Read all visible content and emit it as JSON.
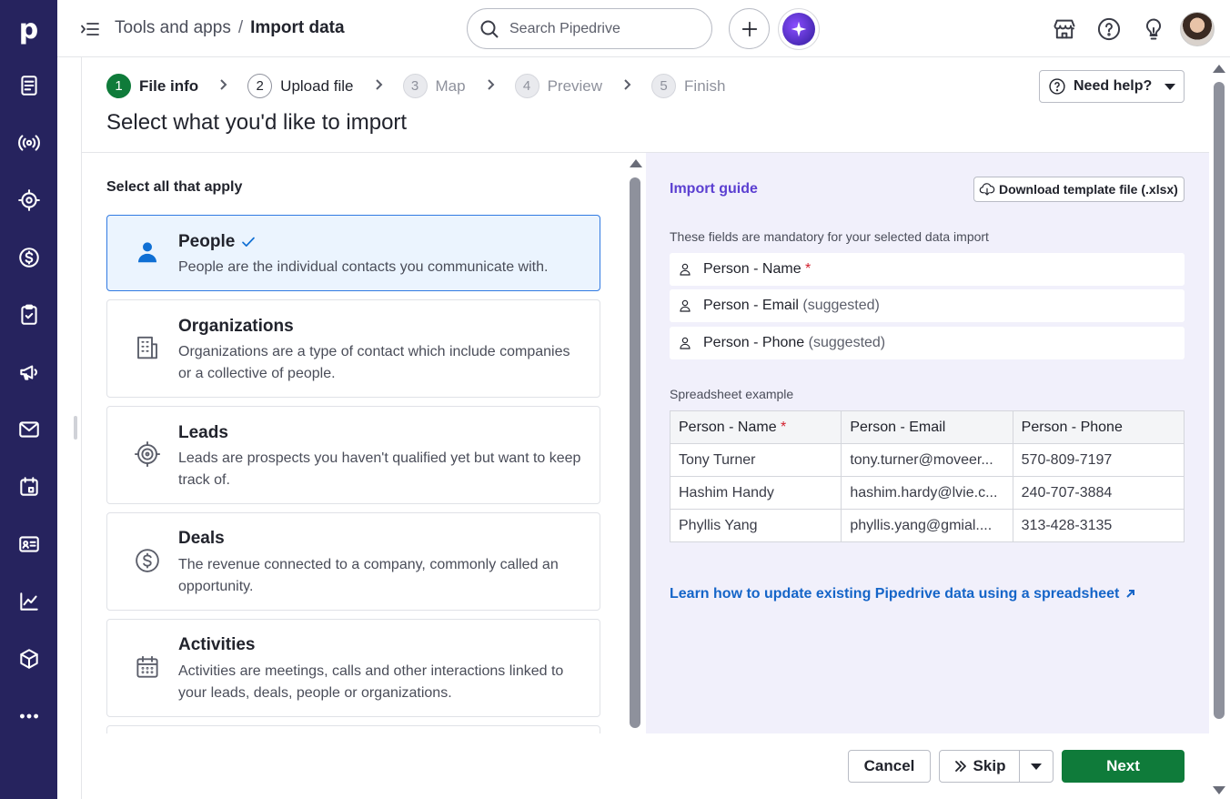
{
  "nav": {
    "logo": "p",
    "items": [
      "leads-inbox-icon",
      "broadcast-icon",
      "target-icon",
      "dollar-icon",
      "clipboard-check-icon",
      "megaphone-icon",
      "mail-icon",
      "calendar-icon",
      "contacts-card-icon",
      "chart-icon",
      "box-icon",
      "more-icon"
    ]
  },
  "topbar": {
    "breadcrumb_parent": "Tools and apps",
    "breadcrumb_sep": "/",
    "breadcrumb_current": "Import data",
    "search_placeholder": "Search Pipedrive"
  },
  "stepper": {
    "steps": [
      {
        "num": "1",
        "label": "File info",
        "state": "active"
      },
      {
        "num": "2",
        "label": "Upload file",
        "state": "done"
      },
      {
        "num": "3",
        "label": "Map",
        "state": "todo"
      },
      {
        "num": "4",
        "label": "Preview",
        "state": "todo"
      },
      {
        "num": "5",
        "label": "Finish",
        "state": "todo"
      }
    ]
  },
  "help": {
    "label": "Need help?"
  },
  "page": {
    "title": "Select what you'd like to import"
  },
  "left": {
    "select_all": "Select all that apply",
    "cards": [
      {
        "title": "People",
        "desc": "People are the individual contacts you communicate with.",
        "selected": true,
        "icon": "person-icon"
      },
      {
        "title": "Organizations",
        "desc": "Organizations are a type of contact which include companies or a collective of people.",
        "selected": false,
        "icon": "building-icon"
      },
      {
        "title": "Leads",
        "desc": "Leads are prospects you haven't qualified yet but want to keep track of.",
        "selected": false,
        "icon": "target-icon"
      },
      {
        "title": "Deals",
        "desc": "The revenue connected to a company, commonly called an opportunity.",
        "selected": false,
        "icon": "dollar-icon"
      },
      {
        "title": "Activities",
        "desc": "Activities are meetings, calls and other interactions linked to your leads, deals, people or organizations.",
        "selected": false,
        "icon": "calendar-icon"
      }
    ]
  },
  "guide": {
    "title": "Import guide",
    "download_label": "Download template file (.xlsx)",
    "mandatory_text": "These fields are mandatory for your selected data import",
    "fields": [
      {
        "label": "Person - Name",
        "required": "*",
        "suggested": ""
      },
      {
        "label": "Person - Email",
        "required": "",
        "suggested": "(suggested)"
      },
      {
        "label": "Person - Phone",
        "required": "",
        "suggested": "(suggested)"
      }
    ],
    "spreadsheet_label": "Spreadsheet example",
    "table": {
      "headers": [
        "Person - Name",
        "Person - Email",
        "Person - Phone"
      ],
      "rows": [
        [
          "Tony Turner",
          "tony.turner@moveer...",
          "570-809-7197"
        ],
        [
          "Hashim Handy",
          "hashim.hardy@lvie.c...",
          "240-707-3884"
        ],
        [
          "Phyllis Yang",
          "phyllis.yang@gmial....",
          "313-428-3135"
        ]
      ]
    },
    "learn_link": "Learn how to update existing Pipedrive data using a spreadsheet"
  },
  "footer": {
    "cancel": "Cancel",
    "skip": "Skip",
    "next": "Next"
  },
  "colors": {
    "nav_bg": "#26235e",
    "primary_green": "#0f7b3a",
    "link_blue": "#1565c8",
    "guide_bg": "#f1f0fb",
    "guide_title": "#5b3fd1",
    "selected_bg": "#ebf4fe",
    "selected_border": "#317ae2"
  }
}
